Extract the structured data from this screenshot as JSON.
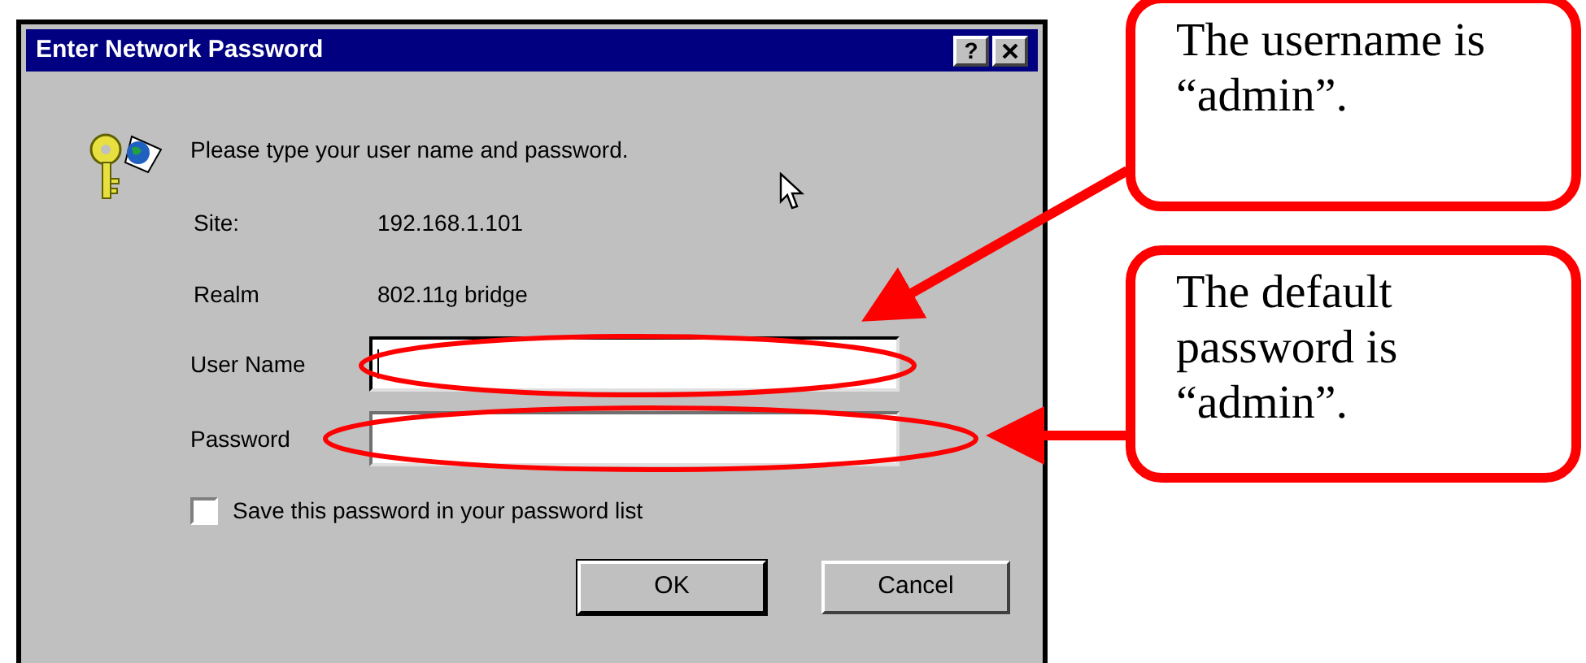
{
  "window": {
    "title": "Enter Network Password",
    "help_button": "?"
  },
  "prompt": "Please type your user name and password.",
  "info": [
    {
      "label": "Site:",
      "value": "192.168.1.101"
    },
    {
      "label": "Realm",
      "value": "802.11g bridge"
    }
  ],
  "fields": [
    {
      "label": "User Name",
      "focused": true
    },
    {
      "label": "Password",
      "focused": false
    }
  ],
  "save_password": {
    "label": "Save this password in your password list",
    "checked": false
  },
  "buttons": [
    {
      "label": "OK",
      "default": true
    },
    {
      "label": "Cancel",
      "default": false
    }
  ],
  "callouts": [
    {
      "lines": [
        "The username is",
        "“admin”."
      ]
    },
    {
      "lines": [
        "The default",
        "password is",
        "“admin”."
      ]
    }
  ]
}
